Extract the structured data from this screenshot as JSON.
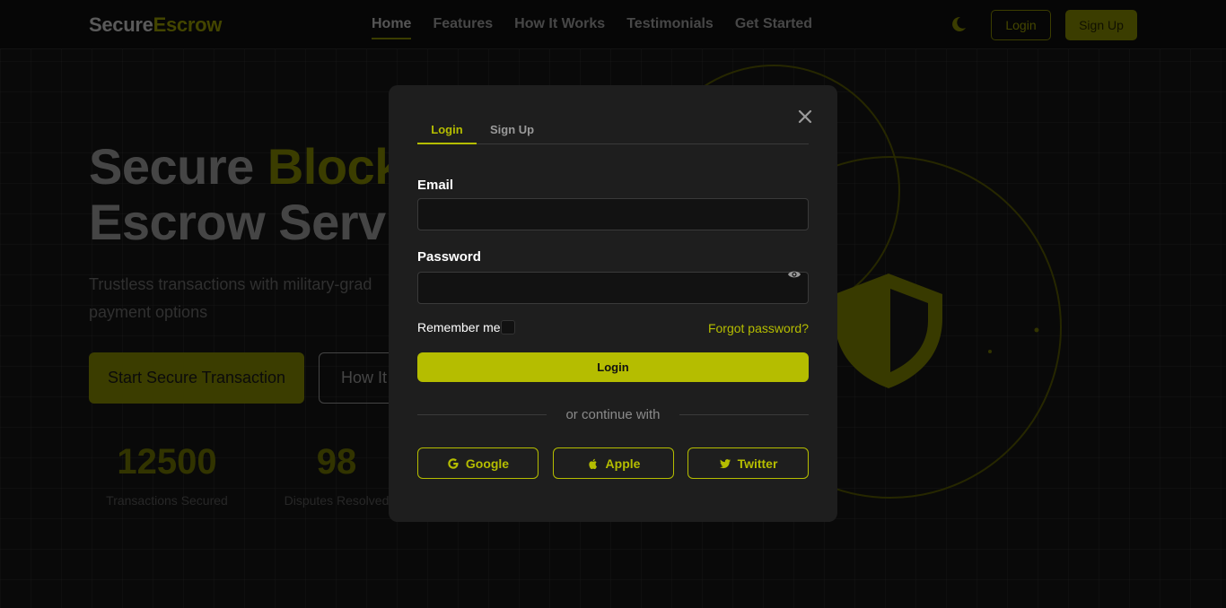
{
  "navbar": {
    "logo_part1": "Secure",
    "logo_part2": "Escrow",
    "links": [
      "Home",
      "Features",
      "How It Works",
      "Testimonials",
      "Get Started"
    ],
    "active_link": "Home",
    "theme_icon": "moon-icon",
    "login_label": "Login",
    "signup_label": "Sign Up"
  },
  "hero": {
    "title_line1_a": "Secure ",
    "title_line1_b": "Block",
    "title_line2": "Escrow Servi",
    "subtitle_line1": "Trustless transactions with military-grad",
    "subtitle_line2": "payment options",
    "primary_button": "Start Secure Transaction",
    "secondary_button": "How It",
    "stats": [
      {
        "value": "12500",
        "label": "Transactions Secured"
      },
      {
        "value": "98",
        "label": "Disputes Resolved"
      }
    ],
    "decor_icon": "shield-icon"
  },
  "modal": {
    "tabs": [
      "Login",
      "Sign Up"
    ],
    "active_tab": "Login",
    "email_label": "Email",
    "email_value": "",
    "password_label": "Password",
    "password_value": "",
    "remember_label": "Remember me",
    "remember_checked": false,
    "forgot_label": "Forgot password?",
    "submit_label": "Login",
    "divider_text": "or continue with",
    "social": [
      {
        "label": "Google",
        "icon": "google-icon"
      },
      {
        "label": "Apple",
        "icon": "apple-icon"
      },
      {
        "label": "Twitter",
        "icon": "twitter-icon"
      }
    ]
  },
  "colors": {
    "accent": "#b5bd00",
    "modal_bg": "#1e1e1e",
    "page_bg": "#0f0f0f"
  }
}
